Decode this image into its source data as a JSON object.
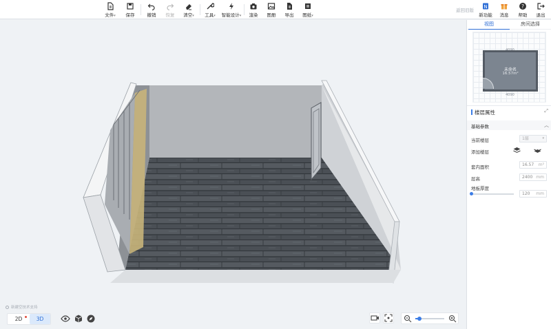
{
  "toolbar": {
    "items": [
      {
        "label": "文件",
        "icon": "file-icon",
        "caret": "▾"
      },
      {
        "label": "保存",
        "icon": "save-icon"
      },
      {
        "label": "撤销",
        "icon": "undo-icon"
      },
      {
        "label": "恢复",
        "icon": "redo-icon",
        "disabled": true
      },
      {
        "label": "清空",
        "icon": "eraser-icon",
        "caret": "▾"
      },
      {
        "label": "工具",
        "icon": "wrench-icon",
        "caret": "▾"
      },
      {
        "label": "智能设计",
        "icon": "lightning-icon",
        "caret": "▾"
      },
      {
        "label": "渲染",
        "icon": "camera-icon"
      },
      {
        "label": "图册",
        "icon": "album-icon"
      },
      {
        "label": "导出",
        "icon": "export-icon"
      },
      {
        "label": "图纸",
        "icon": "drawing-icon",
        "caret": "▾"
      }
    ],
    "back_link": "返回旧版",
    "right_items": [
      {
        "label": "新功能",
        "icon": "new-feature-icon"
      },
      {
        "label": "消息",
        "icon": "gift-icon"
      },
      {
        "label": "帮助",
        "icon": "help-icon"
      },
      {
        "label": "退出",
        "icon": "logout-icon"
      }
    ]
  },
  "canvas": {
    "hint": "新建空技术支持",
    "modes": {
      "two_d": "2D",
      "three_d": "3D",
      "active": "3D"
    }
  },
  "zoom": {
    "level": 0.15
  },
  "panel": {
    "tabs": [
      {
        "label": "视图",
        "active": true
      },
      {
        "label": "房间选择",
        "active": false
      }
    ],
    "minimap": {
      "room_name": "未命名",
      "room_area": "16.57m²",
      "dim_top": "4090",
      "dim_bottom": "4090"
    },
    "section_title": "楼层属性",
    "subsection": "基础参数",
    "rows": {
      "current_floor": {
        "label": "当前楼层",
        "value": "1层",
        "unit": "▾"
      },
      "add_floor": {
        "label": "添加楼层"
      },
      "indoor_area": {
        "label": "套内面积",
        "value": "16.57",
        "unit": "m²"
      },
      "floor_height": {
        "label": "层高",
        "value": "2400",
        "unit": "mm"
      },
      "floor_thickness": {
        "label": "地板厚度",
        "value": "120",
        "unit": "mm",
        "slider_level": 0
      }
    }
  },
  "colors": {
    "accent": "#2f6fd6",
    "floor": "#4a4f55",
    "wall": "#cfd2d6"
  }
}
